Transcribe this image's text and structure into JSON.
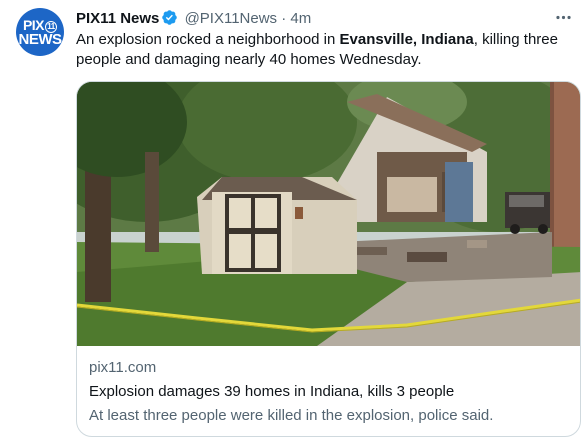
{
  "account": {
    "avatar_line1": "PIX",
    "avatar_ring": "11",
    "avatar_line2": "NEWS",
    "name": "PIX11 News",
    "handle": "@PIX11News",
    "separator": "·",
    "timestamp": "4m"
  },
  "tweet": {
    "text_1": "An explosion rocked a neighborhood in ",
    "text_bold": "Evansville, Indiana",
    "text_2": ", killing three people and damaging nearly 40 homes Wednesday."
  },
  "card": {
    "domain": "pix11.com",
    "title": "Explosion damages 39 homes in Indiana, kills 3 people",
    "description": "At least three people were killed in the explosion, police said."
  },
  "icons": {
    "verified": "verified-badge-icon",
    "more": "more-options-icon"
  },
  "colors": {
    "avatar_bg": "#1d66c6",
    "verified": "#1d9bf0",
    "secondary_text": "#536471",
    "card_border": "#cfd9de"
  }
}
